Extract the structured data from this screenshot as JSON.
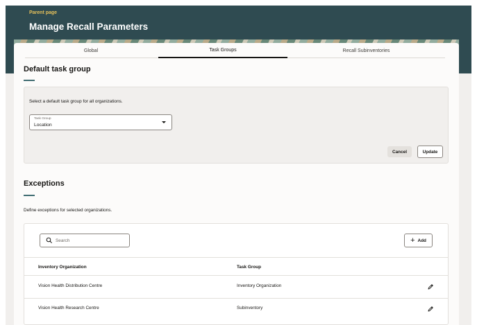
{
  "header": {
    "breadcrumb": "Parent page",
    "title": "Manage Recall Parameters"
  },
  "tabs": [
    {
      "label": "Global",
      "active": false
    },
    {
      "label": "Task Groups",
      "active": true
    },
    {
      "label": "Recall Subinventories",
      "active": false
    }
  ],
  "default_section": {
    "title": "Default task group",
    "description": "Select a default task group for all organizations.",
    "select": {
      "label": "Task Group",
      "value": "Location"
    },
    "cancel_label": "Cancel",
    "update_label": "Update"
  },
  "exceptions": {
    "title": "Exceptions",
    "description": "Define exceptions for selected organizations.",
    "search_placeholder": "Search",
    "add_label": "Add",
    "columns": [
      "Inventory Organization",
      "Task Group"
    ],
    "rows": [
      {
        "organization": "Vision Health Distribution Centre",
        "task_group": "Inventory Organization"
      },
      {
        "organization": "Vision Health Research Centre",
        "task_group": "Subinventory"
      }
    ]
  },
  "colors": {
    "header_bg": "#2f4b51",
    "breadcrumb": "#e6c15a",
    "accent_bar": "#3e6b70"
  }
}
